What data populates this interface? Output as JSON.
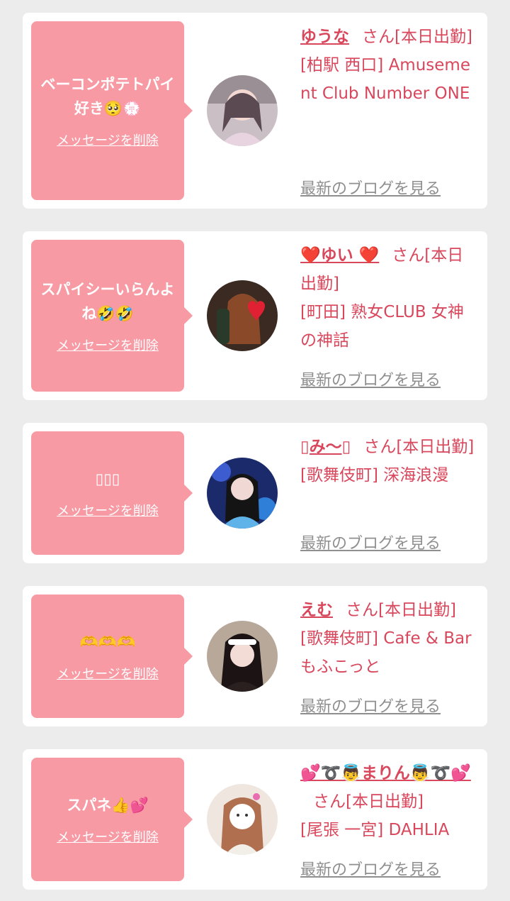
{
  "labels": {
    "delete": "メッセージを削除",
    "blog": "最新のブログを見る",
    "san": "さん[本日出勤]"
  },
  "colors": {
    "bubble": "#f79aa4",
    "accent": "#d8475c",
    "link_gray": "#8f8f8f",
    "background": "#ececec",
    "card": "#ffffff"
  },
  "cards": [
    {
      "message": "ベーコンポテトパイ好き🥺💮",
      "name": "ゆうな",
      "shop": "[柏駅 西口] Amusement Club Number ONE"
    },
    {
      "message": "スパイシーいらんよね🤣🤣",
      "name": "❤️ゆい ❤️",
      "shop": "[町田] 熟女CLUB 女神の神話"
    },
    {
      "message": "▯▯▯",
      "name": "▯み〜▯",
      "shop": "[歌舞伎町] 深海浪漫"
    },
    {
      "message": "🫶🫶🫶",
      "name": "えむ",
      "shop": "[歌舞伎町] Cafe & Bar もふこっと"
    },
    {
      "message": "スパネ👍💕",
      "name": "💕➰👼まりん👼➰💕",
      "shop": "[尾張 一宮] DAHLIA"
    }
  ]
}
